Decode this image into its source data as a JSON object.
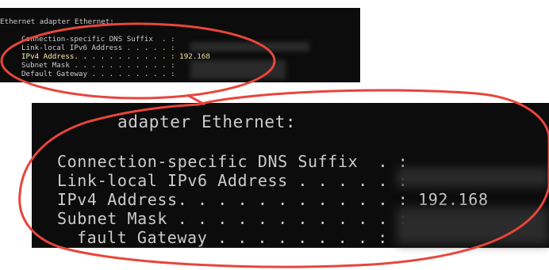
{
  "terminal": {
    "heading": "Ethernet adapter Ethernet:",
    "rows": [
      {
        "label": "Connection-specific DNS Suffix  . :",
        "value": ""
      },
      {
        "label": "Link-local IPv6 Address . . . . . :",
        "value": ""
      },
      {
        "label": "IPv4 Address. . . . . . . . . . . :",
        "value": "192.168"
      },
      {
        "label": "Subnet Mask . . . . . . . . . . . :",
        "value": ""
      },
      {
        "label": "Default Gateway . . . . . . . . . :",
        "value": ""
      }
    ]
  },
  "zoom": {
    "heading": "adapter Ethernet:",
    "rows": [
      {
        "label": "Connection-specific DNS Suffix  . :"
      },
      {
        "label": "Link-local IPv6 Address . . . . . :"
      },
      {
        "label": "IPv4 Address. . . . . . . . . . . :",
        "value": "192.168"
      },
      {
        "label": "Subnet Mask . . . . . . . . . . . :"
      },
      {
        "label": "fault Gateway . . . . . . . . :"
      }
    ]
  },
  "colors": {
    "terminal_bg": "#0c0c0c",
    "terminal_text": "#cccccc",
    "highlight_text": "#f9f1a5",
    "annotation": "#e8453c"
  }
}
